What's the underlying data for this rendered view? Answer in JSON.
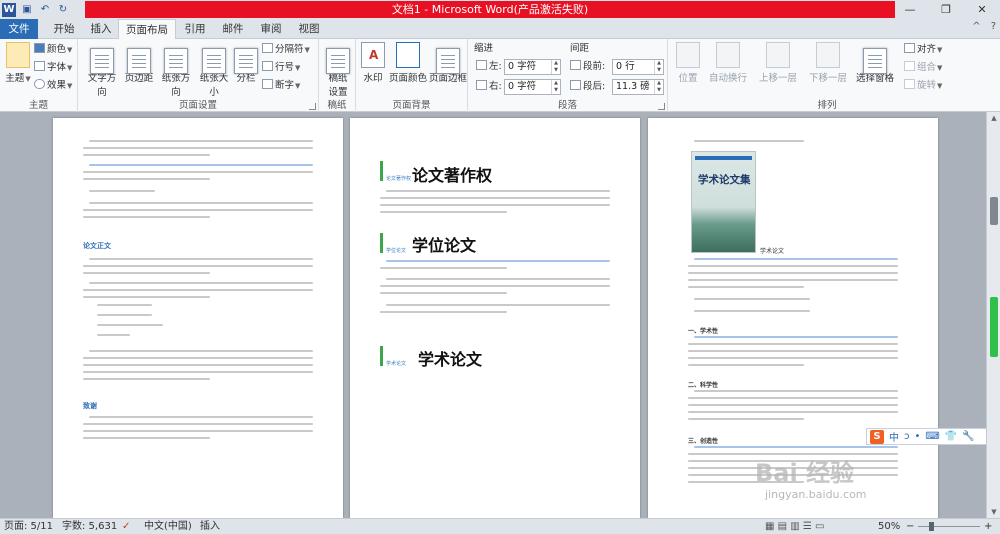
{
  "window": {
    "title": "文档1 - Microsoft Word(产品激活失败)",
    "controls": {
      "minimize": "—",
      "restore": "❐",
      "close": "✕"
    }
  },
  "qat": {
    "icons": [
      "word-logo",
      "save-icon",
      "undo-icon",
      "redo-icon"
    ],
    "undo": "↶",
    "save": "▣",
    "redo": "↻",
    "logo": "W"
  },
  "tabs": [
    {
      "label": "文件"
    },
    {
      "label": "开始"
    },
    {
      "label": "插入"
    },
    {
      "label": "页面布局"
    },
    {
      "label": "引用"
    },
    {
      "label": "邮件"
    },
    {
      "label": "审阅"
    },
    {
      "label": "视图"
    }
  ],
  "tab_right": {
    "up": "^",
    "help": "?"
  },
  "ribbon": {
    "theme": {
      "big": "主题",
      "colors": "颜色",
      "fonts": "字体",
      "effects": "效果",
      "label": "主题"
    },
    "page_setup": {
      "text_direction": "文字方向",
      "margins": "页边距",
      "orientation": "纸张方向",
      "size": "纸张大小",
      "columns": "分栏",
      "breaks": "分隔符",
      "line_numbers": "行号",
      "hyphenation": "断字",
      "label": "页面设置"
    },
    "draft": {
      "line1": "稿纸",
      "line2": "设置",
      "label": "稿纸"
    },
    "page_background": {
      "watermark": "水印",
      "page_color": "页面颜色",
      "page_borders": "页面边框",
      "label": "页面背景"
    },
    "paragraph": {
      "indent_title": "缩进",
      "spacing_title": "间距",
      "left_label": "左:",
      "left_value": "0 字符",
      "right_label": "右:",
      "right_value": "0 字符",
      "before_label": "段前:",
      "before_value": "0 行",
      "after_label": "段后:",
      "after_value": "11.3 磅",
      "label": "段落"
    },
    "arrange": {
      "position": "位置",
      "wrap": "自动换行",
      "bring_forward": "上移一层",
      "send_backward": "下移一层",
      "selection_pane": "选择窗格",
      "align": "对齐",
      "group": "组合",
      "rotate": "旋转",
      "label": "排列"
    }
  },
  "pages": {
    "p2": {
      "headings": [
        "论文著作权",
        "学位论文",
        "学术论文"
      ],
      "heading_small": [
        "论文著作权",
        "学位论文",
        "学术论文"
      ]
    },
    "p1": {
      "subheads": [
        "论文正文",
        "致谢"
      ]
    },
    "p3": {
      "book_title": "学术论文集",
      "caption": "学术论文",
      "subheads": [
        "一、学术性",
        "二、科学性",
        "三、创造性"
      ]
    }
  },
  "ime": {
    "logo": "S",
    "mode": "中",
    "items": [
      "ↄ",
      "•",
      "⌨",
      "👕",
      "🔧"
    ]
  },
  "watermark": {
    "text": "Bai 经验",
    "url": "jingyan.baidu.com"
  },
  "status": {
    "page": "页面: 5/11",
    "words": "字数: 5,631",
    "lang": "中文(中国)",
    "mode": "插入",
    "zoom": "50%",
    "zoom_out": "−",
    "zoom_in": "+"
  }
}
